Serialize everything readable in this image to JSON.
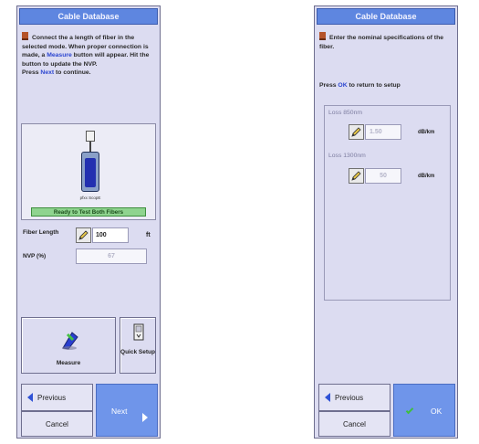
{
  "left_panel": {
    "title": "Cable Database",
    "instruction_part1": "Connect the a length of fiber in the selected mode. When proper connection is made, a ",
    "instruction_highlight": "Measure",
    "instruction_part2": " button will appear. Hit the button to update the NVP.",
    "instruction_press": "Press ",
    "instruction_next_word": "Next",
    "instruction_end": " to continue.",
    "module_label": "pfxx ScopE",
    "status_text": "Ready to Test Both Fibers",
    "fiber_length_label": "Fiber Length",
    "fiber_length_value": "100",
    "fiber_length_unit": "ft",
    "nvp_label": "NVP (%)",
    "nvp_value": "67",
    "measure_label": "Measure",
    "quick_setup_label": "Quick Setup",
    "previous_label": "Previous",
    "cancel_label": "Cancel",
    "next_label": "Next"
  },
  "right_panel": {
    "title": "Cable Database",
    "instruction": "Enter the nominal specifications of the fiber.",
    "press_prefix": "Press ",
    "press_ok": "OK",
    "press_suffix": " to return to setup",
    "loss1_label": "Loss 850nm",
    "loss1_value": "1.50",
    "loss1_unit": "dB/km",
    "loss2_label": "Loss 1300nm",
    "loss2_value": "50",
    "loss2_unit": "dB/km",
    "previous_label": "Previous",
    "cancel_label": "Cancel",
    "ok_label": "OK"
  },
  "colors": {
    "panel": "#dcdcf1",
    "title_bar": "#5e86e0",
    "primary_button": "#6f95ea",
    "status_ok": "#8fd48f",
    "link": "#2c46d0"
  }
}
